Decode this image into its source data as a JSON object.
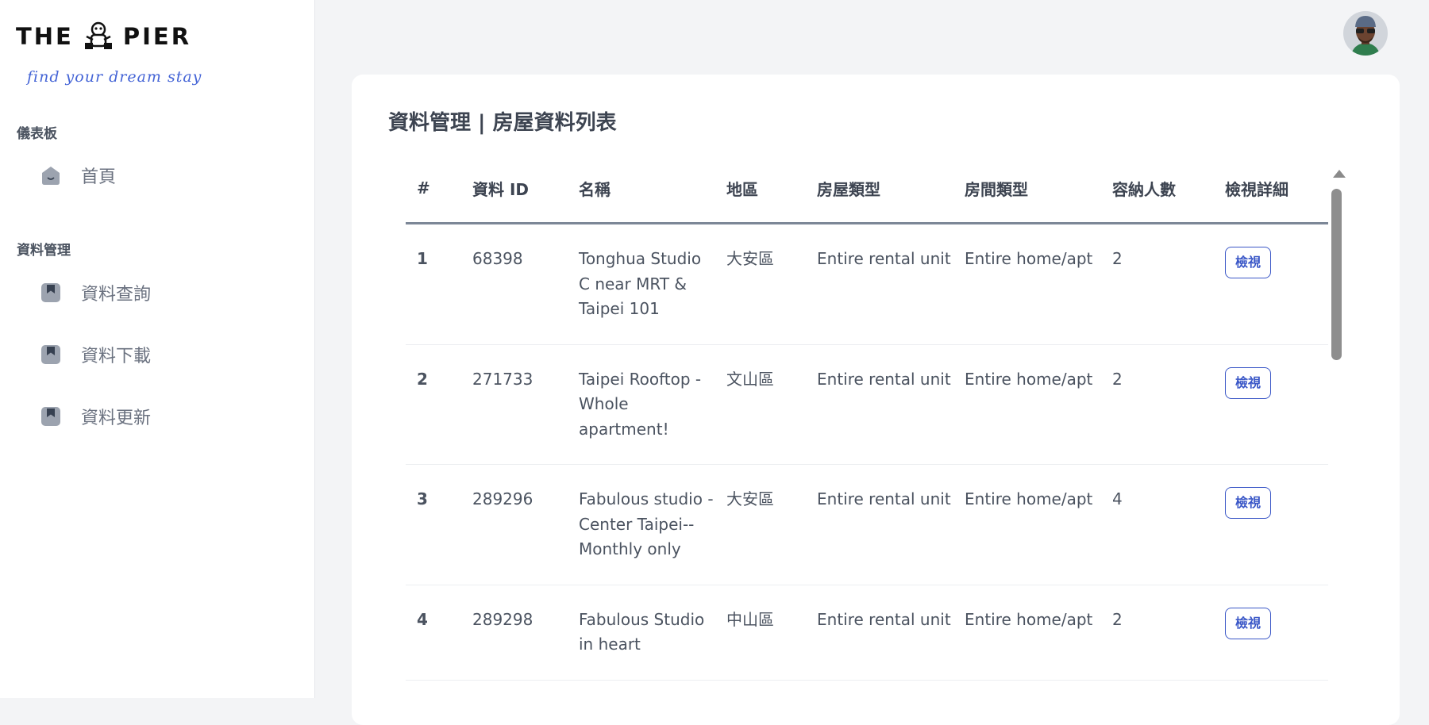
{
  "logo": {
    "left_text": "THE",
    "right_text": "PIER",
    "tagline": "find your dream stay"
  },
  "sidebar": {
    "sections": [
      {
        "title": "儀表板",
        "items": [
          {
            "label": "首頁",
            "icon": "home-icon"
          }
        ]
      },
      {
        "title": "資料管理",
        "items": [
          {
            "label": "資料查詢",
            "icon": "bookmark-icon"
          },
          {
            "label": "資料下載",
            "icon": "bookmark-icon"
          },
          {
            "label": "資料更新",
            "icon": "bookmark-icon"
          }
        ]
      }
    ]
  },
  "page": {
    "title": "資料管理 | 房屋資料列表"
  },
  "table": {
    "headers": [
      "#",
      "資料 ID",
      "名稱",
      "地區",
      "房屋類型",
      "房間類型",
      "容納人數",
      "檢視詳細"
    ],
    "rows": [
      {
        "idx": "1",
        "id": "68398",
        "name": "Tonghua Studio C near MRT & Taipei 101",
        "district": "大安區",
        "property_type": "Entire rental unit",
        "room_type": "Entire home/apt",
        "capacity": "2",
        "action": "檢視"
      },
      {
        "idx": "2",
        "id": "271733",
        "name": "Taipei Rooftop - Whole apartment!",
        "district": "文山區",
        "property_type": "Entire rental unit",
        "room_type": "Entire home/apt",
        "capacity": "2",
        "action": "檢視"
      },
      {
        "idx": "3",
        "id": "289296",
        "name": "Fabulous studio - Center Taipei--Monthly only",
        "district": "大安區",
        "property_type": "Entire rental unit",
        "room_type": "Entire home/apt",
        "capacity": "4",
        "action": "檢視"
      },
      {
        "idx": "4",
        "id": "289298",
        "name": "Fabulous Studio in heart",
        "district": "中山區",
        "property_type": "Entire rental unit",
        "room_type": "Entire home/apt",
        "capacity": "2",
        "action": "檢視"
      }
    ]
  },
  "colors": {
    "accent": "#3a57c7",
    "tagline": "#4464d6",
    "background": "#f3f4f6",
    "card": "#ffffff"
  }
}
